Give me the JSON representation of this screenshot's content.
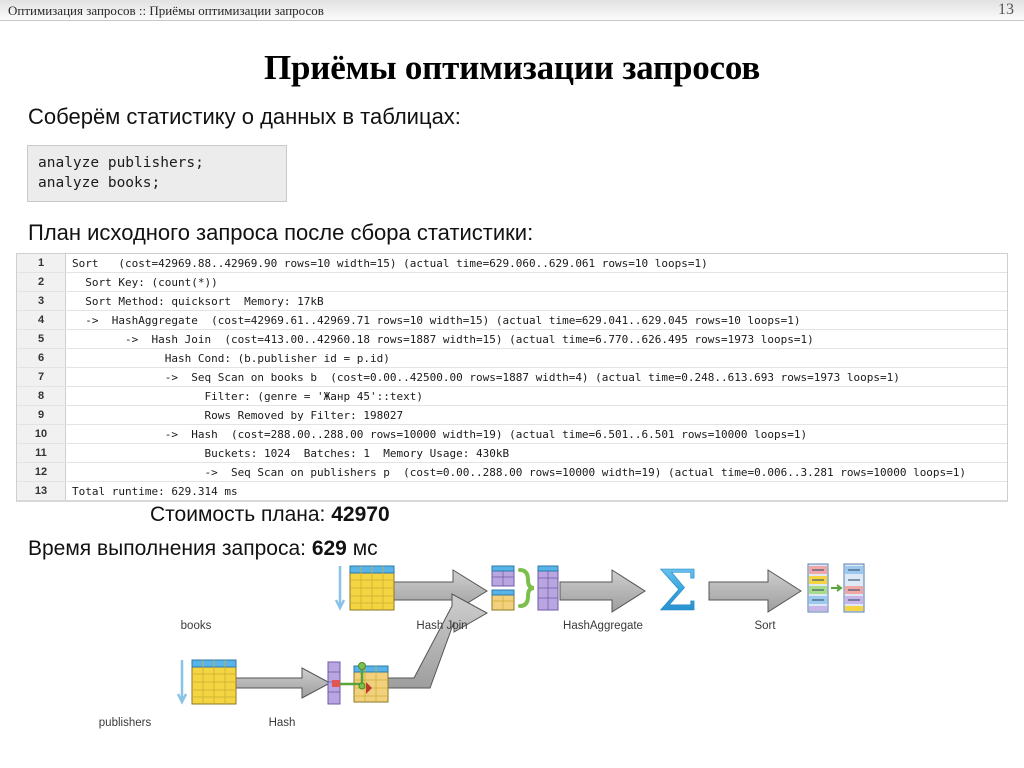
{
  "header": {
    "breadcrumb": "Оптимизация запросов  ::  Приёмы оптимизации запросов",
    "page_number": "13"
  },
  "slide": {
    "title": "Приёмы оптимизации запросов",
    "lead_1": "Соберём статистику о данных в таблицах:",
    "lead_2": "План исходного запроса после сбора статистики:",
    "code": "analyze publishers;\nanalyze books;"
  },
  "plan": {
    "rows": [
      {
        "n": "1",
        "text": "Sort   (cost=42969.88..42969.90 rows=10 width=15) (actual time=629.060..629.061 rows=10 loops=1)"
      },
      {
        "n": "2",
        "text": "  Sort Key: (count(*))"
      },
      {
        "n": "3",
        "text": "  Sort Method: quicksort  Memory: 17kB"
      },
      {
        "n": "4",
        "text": "  ->  HashAggregate  (cost=42969.61..42969.71 rows=10 width=15) (actual time=629.041..629.045 rows=10 loops=1)"
      },
      {
        "n": "5",
        "text": "        ->  Hash Join  (cost=413.00..42960.18 rows=1887 width=15) (actual time=6.770..626.495 rows=1973 loops=1)"
      },
      {
        "n": "6",
        "text": "              Hash Cond: (b.publisher id = p.id)"
      },
      {
        "n": "7",
        "text": "              ->  Seq Scan on books b  (cost=0.00..42500.00 rows=1887 width=4) (actual time=0.248..613.693 rows=1973 loops=1)"
      },
      {
        "n": "8",
        "text": "                    Filter: (genre = 'Жанр 45'::text)"
      },
      {
        "n": "9",
        "text": "                    Rows Removed by Filter: 198027"
      },
      {
        "n": "10",
        "text": "              ->  Hash  (cost=288.00..288.00 rows=10000 width=19) (actual time=6.501..6.501 rows=10000 loops=1)"
      },
      {
        "n": "11",
        "text": "                    Buckets: 1024  Batches: 1  Memory Usage: 430kB"
      },
      {
        "n": "12",
        "text": "                    ->  Seq Scan on publishers p  (cost=0.00..288.00 rows=10000 width=19) (actual time=0.006..3.281 rows=10000 loops=1)"
      },
      {
        "n": "13",
        "text": "Total runtime: 629.314 ms"
      }
    ]
  },
  "summary": {
    "cost_label": "Стоимость плана:",
    "cost_value": "42970",
    "time_label": "Время выполнения запроса:",
    "time_value": "629",
    "time_unit": "мс"
  },
  "diagram": {
    "nodes": [
      {
        "id": "publishers",
        "label": "publishers"
      },
      {
        "id": "hash",
        "label": "Hash"
      },
      {
        "id": "books",
        "label": "books"
      },
      {
        "id": "hashjoin",
        "label": "Hash Join"
      },
      {
        "id": "hashaggregate",
        "label": "HashAggregate"
      },
      {
        "id": "sort",
        "label": "Sort"
      }
    ]
  },
  "colors": {
    "table_yellow": "#f5d442",
    "table_header_blue": "#58b4e8",
    "arrow_gray": "#b0b0b0",
    "sigma_blue": "#3fa9e0",
    "accent_green": "#6aab3a"
  }
}
